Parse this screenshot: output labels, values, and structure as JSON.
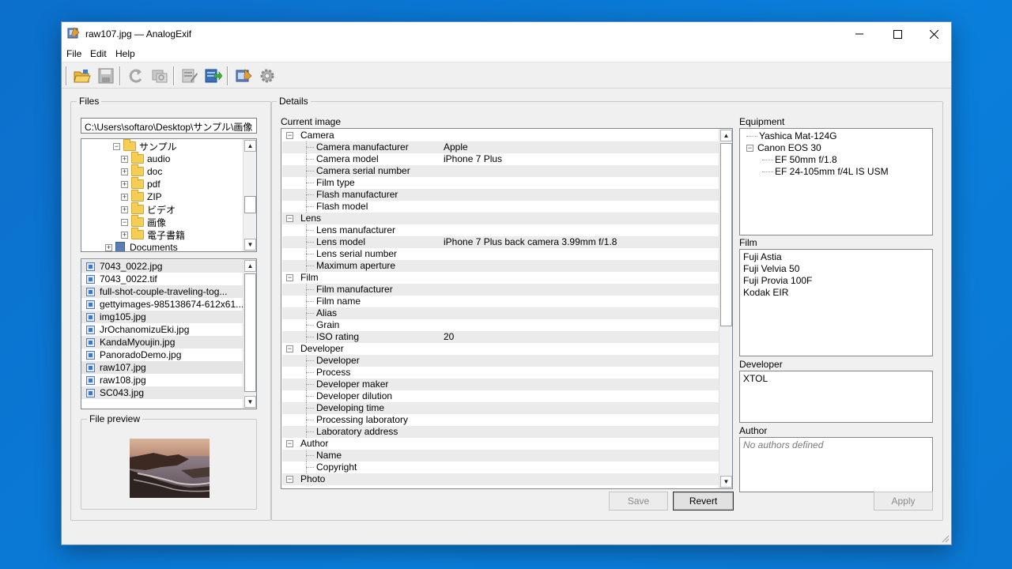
{
  "window": {
    "title": "raw107.jpg — AnalogExif"
  },
  "menu": [
    "File",
    "Edit",
    "Help"
  ],
  "toolbar": {
    "buttons": [
      "open-folder",
      "save",
      "revert",
      "copy-metadata",
      "batch-edit",
      "export",
      "edit-gear-list",
      "settings"
    ]
  },
  "files_group": {
    "title": "Files",
    "path": "C:\\Users\\softaro\\Desktop\\サンプル\\画像",
    "tree": [
      {
        "label": "サンプル",
        "expander": "−",
        "indent": 1,
        "type": "folder"
      },
      {
        "label": "audio",
        "expander": "+",
        "indent": 2,
        "type": "folder"
      },
      {
        "label": "doc",
        "expander": "+",
        "indent": 2,
        "type": "folder"
      },
      {
        "label": "pdf",
        "expander": "+",
        "indent": 2,
        "type": "folder"
      },
      {
        "label": "ZIP",
        "expander": "+",
        "indent": 2,
        "type": "folder"
      },
      {
        "label": "ビデオ",
        "expander": "+",
        "indent": 2,
        "type": "folder"
      },
      {
        "label": "画像",
        "expander": "−",
        "indent": 2,
        "type": "folder"
      },
      {
        "label": "電子書籍",
        "expander": "+",
        "indent": 2,
        "type": "folder"
      },
      {
        "label": "Documents",
        "expander": "+",
        "indent": 0,
        "type": "docs"
      }
    ],
    "files": [
      "7043_0022.jpg",
      "7043_0022.tif",
      "full-shot-couple-traveling-tog...",
      "gettyimages-985138674-612x61...",
      "img105.jpg",
      "JrOchanomizuEki.jpg",
      "KandaMyoujin.jpg",
      "PanoradoDemo.jpg",
      "raw107.jpg",
      "raw108.jpg",
      "SC043.jpg"
    ],
    "preview_title": "File preview"
  },
  "details_group": {
    "title": "Details",
    "current_image_label": "Current image",
    "rows": [
      {
        "label": "Camera",
        "value": "",
        "category": true
      },
      {
        "label": "Camera manufacturer",
        "value": "Apple",
        "category": false
      },
      {
        "label": "Camera model",
        "value": "iPhone 7 Plus",
        "category": false
      },
      {
        "label": "Camera serial number",
        "value": "",
        "category": false
      },
      {
        "label": "Film type",
        "value": "",
        "category": false
      },
      {
        "label": "Flash manufacturer",
        "value": "",
        "category": false
      },
      {
        "label": "Flash model",
        "value": "",
        "category": false
      },
      {
        "label": "Lens",
        "value": "",
        "category": true
      },
      {
        "label": "Lens manufacturer",
        "value": "",
        "category": false
      },
      {
        "label": "Lens model",
        "value": "iPhone 7 Plus back camera 3.99mm f/1.8",
        "category": false
      },
      {
        "label": "Lens serial number",
        "value": "",
        "category": false
      },
      {
        "label": "Maximum aperture",
        "value": "",
        "category": false
      },
      {
        "label": "Film",
        "value": "",
        "category": true
      },
      {
        "label": "Film manufacturer",
        "value": "",
        "category": false
      },
      {
        "label": "Film name",
        "value": "",
        "category": false
      },
      {
        "label": "Alias",
        "value": "",
        "category": false
      },
      {
        "label": "Grain",
        "value": "",
        "category": false
      },
      {
        "label": "ISO rating",
        "value": "20",
        "category": false
      },
      {
        "label": "Developer",
        "value": "",
        "category": true
      },
      {
        "label": "Developer",
        "value": "",
        "category": false
      },
      {
        "label": "Process",
        "value": "",
        "category": false
      },
      {
        "label": "Developer maker",
        "value": "",
        "category": false
      },
      {
        "label": "Developer dilution",
        "value": "",
        "category": false
      },
      {
        "label": "Developing time",
        "value": "",
        "category": false
      },
      {
        "label": "Processing laboratory",
        "value": "",
        "category": false
      },
      {
        "label": "Laboratory address",
        "value": "",
        "category": false
      },
      {
        "label": "Author",
        "value": "",
        "category": true
      },
      {
        "label": "Name",
        "value": "",
        "category": false
      },
      {
        "label": "Copyright",
        "value": "",
        "category": false
      },
      {
        "label": "Photo",
        "value": "",
        "category": true
      }
    ],
    "save_label": "Save",
    "revert_label": "Revert"
  },
  "equipment": {
    "label": "Equipment",
    "items": [
      {
        "label": "Yashica Mat-124G",
        "level": 0,
        "expander": ""
      },
      {
        "label": "Canon EOS 30",
        "level": 0,
        "expander": "−"
      },
      {
        "label": "EF 50mm f/1.8",
        "level": 1,
        "expander": ""
      },
      {
        "label": "EF 24-105mm f/4L IS USM",
        "level": 1,
        "expander": ""
      }
    ]
  },
  "film": {
    "label": "Film",
    "items": [
      "Fuji Astia",
      "Fuji Velvia 50",
      "Fuji Provia 100F",
      "Kodak EIR"
    ]
  },
  "developer": {
    "label": "Developer",
    "items": [
      "XTOL"
    ]
  },
  "author": {
    "label": "Author",
    "placeholder": "No authors defined"
  },
  "apply_label": "Apply",
  "colors": {
    "desktop": "#0a78d4",
    "window_bg": "#f0f0f0",
    "selected_row": "#e5e5e5"
  }
}
